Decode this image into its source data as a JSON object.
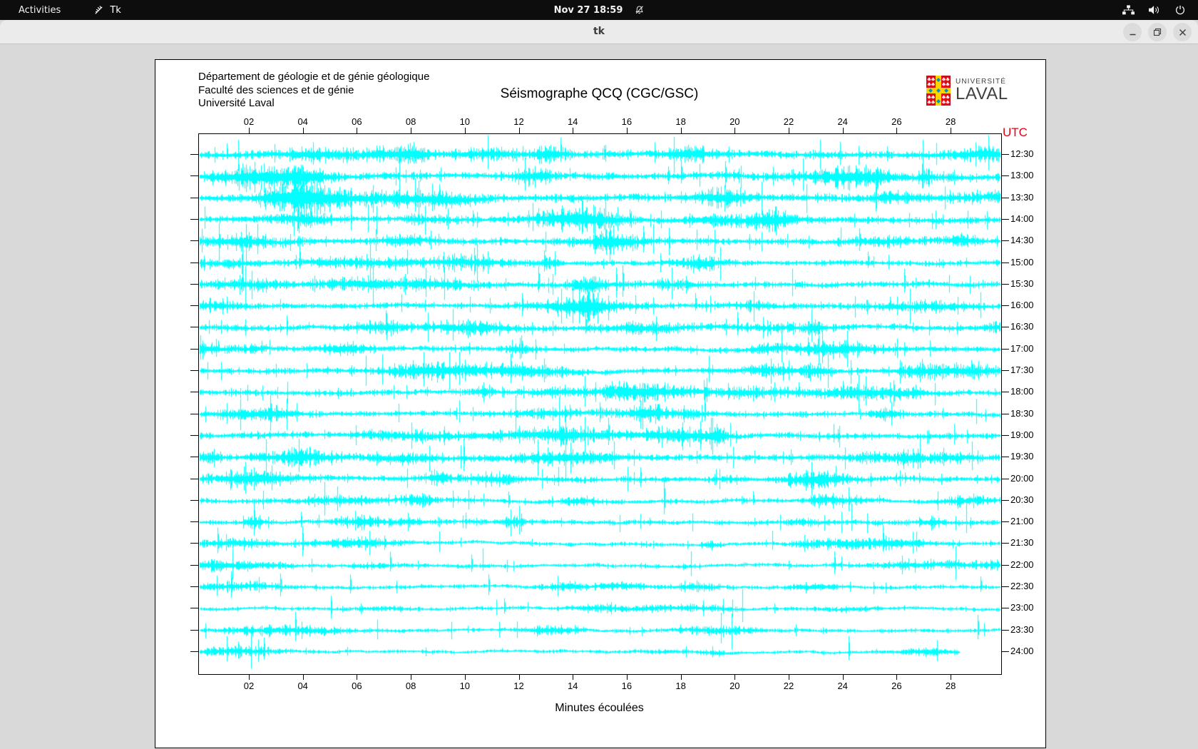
{
  "desktop": {
    "activities_label": "Activities",
    "app_name": "Tk",
    "clock": "Nov 27 18:59"
  },
  "window": {
    "title": "tk"
  },
  "header": {
    "dept_lines": [
      "Département de géologie et de génie géologique",
      "Faculté des sciences et de génie",
      "Université Laval"
    ],
    "logo_line1": "UNIVERSITÉ",
    "logo_line2": "LAVAL"
  },
  "chart_data": {
    "type": "line",
    "subtype": "seismogram-helicorder",
    "title": "Séismographe QCQ (CGC/GSC)",
    "xlabel": "Minutes écoulées",
    "utc_label": "UTC",
    "x_ticks": [
      "02",
      "04",
      "06",
      "08",
      "10",
      "12",
      "14",
      "16",
      "18",
      "20",
      "22",
      "24",
      "26",
      "28"
    ],
    "x_range": [
      0,
      30
    ],
    "grid": false,
    "trace_color": "#00ffff",
    "utc_color": "#e60012",
    "seed": 20241127,
    "rows": [
      {
        "label": "12:30",
        "base": 4.6,
        "spike_rate": 0.03,
        "tall_spikes": 3,
        "bursts": 7,
        "len": 1
      },
      {
        "label": "13:00",
        "base": 4.2,
        "spike_rate": 0.03,
        "tall_spikes": 3,
        "bursts": 7,
        "len": 1
      },
      {
        "label": "13:30",
        "base": 4.6,
        "spike_rate": 0.03,
        "tall_spikes": 2,
        "bursts": 8,
        "len": 1
      },
      {
        "label": "14:00",
        "base": 4.0,
        "spike_rate": 0.035,
        "tall_spikes": 4,
        "bursts": 7,
        "len": 1
      },
      {
        "label": "14:30",
        "base": 3.8,
        "spike_rate": 0.03,
        "tall_spikes": 4,
        "bursts": 6,
        "len": 1
      },
      {
        "label": "15:00",
        "base": 3.2,
        "spike_rate": 0.025,
        "tall_spikes": 3,
        "bursts": 6,
        "len": 1
      },
      {
        "label": "15:30",
        "base": 3.6,
        "spike_rate": 0.035,
        "tall_spikes": 4,
        "bursts": 6,
        "len": 1
      },
      {
        "label": "16:00",
        "base": 3.4,
        "spike_rate": 0.03,
        "tall_spikes": 3,
        "bursts": 6,
        "len": 1
      },
      {
        "label": "16:30",
        "base": 3.6,
        "spike_rate": 0.035,
        "tall_spikes": 4,
        "bursts": 6,
        "len": 1
      },
      {
        "label": "17:00",
        "base": 3.4,
        "spike_rate": 0.03,
        "tall_spikes": 5,
        "bursts": 6,
        "len": 1
      },
      {
        "label": "17:30",
        "base": 3.5,
        "spike_rate": 0.035,
        "tall_spikes": 4,
        "bursts": 7,
        "len": 1
      },
      {
        "label": "18:00",
        "base": 3.4,
        "spike_rate": 0.035,
        "tall_spikes": 3,
        "bursts": 7,
        "len": 1
      },
      {
        "label": "18:30",
        "base": 3.2,
        "spike_rate": 0.035,
        "tall_spikes": 5,
        "bursts": 6,
        "len": 1
      },
      {
        "label": "19:00",
        "base": 3.6,
        "spike_rate": 0.035,
        "tall_spikes": 3,
        "bursts": 7,
        "len": 1
      },
      {
        "label": "19:30",
        "base": 3.8,
        "spike_rate": 0.03,
        "tall_spikes": 3,
        "bursts": 7,
        "len": 1
      },
      {
        "label": "20:00",
        "base": 3.4,
        "spike_rate": 0.035,
        "tall_spikes": 4,
        "bursts": 7,
        "len": 1
      },
      {
        "label": "20:30",
        "base": 2.8,
        "spike_rate": 0.028,
        "tall_spikes": 3,
        "bursts": 6,
        "len": 1
      },
      {
        "label": "21:00",
        "base": 3.0,
        "spike_rate": 0.032,
        "tall_spikes": 5,
        "bursts": 6,
        "len": 1
      },
      {
        "label": "21:30",
        "base": 2.4,
        "spike_rate": 0.022,
        "tall_spikes": 5,
        "bursts": 5,
        "len": 1
      },
      {
        "label": "22:00",
        "base": 2.4,
        "spike_rate": 0.022,
        "tall_spikes": 6,
        "bursts": 5,
        "len": 1
      },
      {
        "label": "22:30",
        "base": 2.4,
        "spike_rate": 0.02,
        "tall_spikes": 5,
        "bursts": 5,
        "len": 1
      },
      {
        "label": "23:00",
        "base": 2.2,
        "spike_rate": 0.02,
        "tall_spikes": 5,
        "bursts": 5,
        "len": 1
      },
      {
        "label": "23:30",
        "base": 2.2,
        "spike_rate": 0.016,
        "tall_spikes": 3,
        "bursts": 5,
        "len": 1
      },
      {
        "label": "24:00",
        "base": 2.0,
        "spike_rate": 0.015,
        "tall_spikes": 3,
        "bursts": 4,
        "len": 0.95
      }
    ]
  },
  "colors": {
    "topbar_bg": "#0d0d0d",
    "titlebar_bg": "#ebebeb",
    "content_bg": "#d9d9d9",
    "canvas_bg": "#ffffff",
    "frame_border": "#000000",
    "trace": "#00ffff",
    "utc_red": "#e60012",
    "logo_red": "#e30613",
    "logo_yellow": "#ffd300",
    "logo_blue": "#0095c8"
  }
}
